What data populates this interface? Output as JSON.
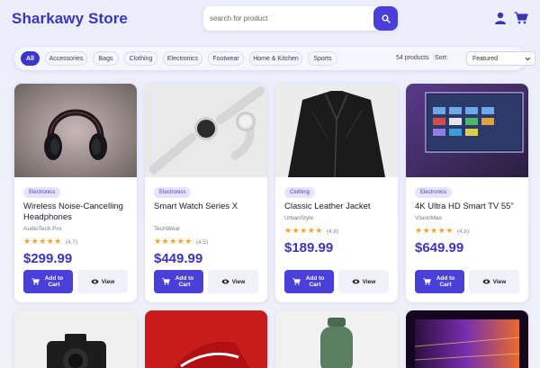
{
  "header": {
    "brand": "Sharkawy Store",
    "search_placeholder": "search for product"
  },
  "filters": {
    "chips": [
      "All",
      "Accessories",
      "Bags",
      "Clothing",
      "Electronics",
      "Footwear",
      "Home & Kitchen",
      "Sports"
    ],
    "active": "All",
    "count": "54 products",
    "sort_label": "Sort:",
    "sort_value": "Featured"
  },
  "products": [
    {
      "category": "Electronics",
      "title": "Wireless Noise-Cancelling Headphones",
      "brand": "AudioTech Pro",
      "stars": "★★★★★",
      "rating": "(4.7)",
      "price": "$299.99",
      "add_label": "Add to Cart",
      "view_label": "View"
    },
    {
      "category": "Electronics",
      "title": "Smart Watch Series X",
      "brand": "TechWear",
      "stars": "★★★★★",
      "rating": "(4.5)",
      "price": "$449.99",
      "add_label": "Add to Cart",
      "view_label": "View"
    },
    {
      "category": "Clothing",
      "title": "Classic Leather Jacket",
      "brand": "UrbanStyle",
      "stars": "★★★★★",
      "rating": "(4.8)",
      "price": "$189.99",
      "add_label": "Add to Cart",
      "view_label": "View"
    },
    {
      "category": "Electronics",
      "title": "4K Ultra HD Smart TV 55\"",
      "brand": "VisionMax",
      "stars": "★★★★★",
      "rating": "(4.6)",
      "price": "$649.99",
      "add_label": "Add to Cart",
      "view_label": "View"
    }
  ],
  "colors": {
    "accent": "#4b3fd9",
    "brand": "#3b35b8",
    "star": "#f3a428"
  },
  "icons": [
    "search-icon",
    "user-icon",
    "cart-icon",
    "chevron-down-icon",
    "eye-icon"
  ]
}
